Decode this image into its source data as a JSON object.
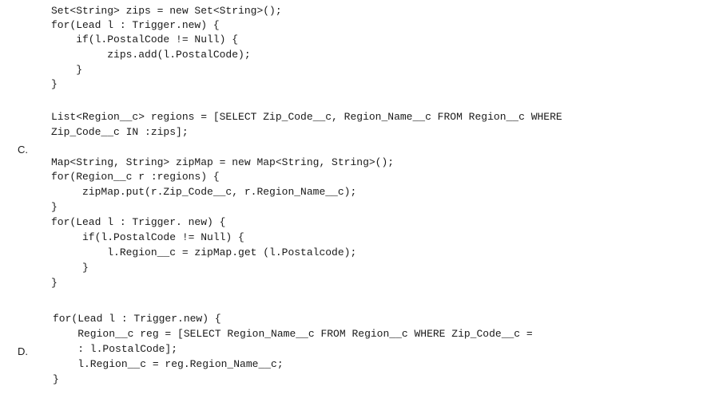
{
  "option_c": {
    "letter": "C.",
    "lines": [
      "Set<String> zips = new Set<String>();",
      "for(Lead l : Trigger.new) {",
      "    if(l.PostalCode != Null) {",
      "         zips.add(l.PostalCode);",
      "    }",
      "}",
      "List<Region__c> regions = [SELECT Zip_Code__c, Region_Name__c FROM Region__c WHERE",
      "Zip_Code__c IN :zips];",
      "Map<String, String> zipMap = new Map<String, String>();",
      "for(Region__c r :regions) {",
      "     zipMap.put(r.Zip_Code__c, r.Region_Name__c);",
      "}",
      "for(Lead l : Trigger. new) {",
      "     if(l.PostalCode != Null) {",
      "         l.Region__c = zipMap.get (l.Postalcode);",
      "     }",
      "}"
    ]
  },
  "option_d": {
    "letter": "D.",
    "lines": [
      "for(Lead l : Trigger.new) {",
      "    Region__c reg = [SELECT Region_Name__c FROM Region__c WHERE Zip_Code__c =",
      "    : l.PostalCode];",
      "    l.Region__c = reg.Region_Name__c;",
      "}"
    ]
  }
}
